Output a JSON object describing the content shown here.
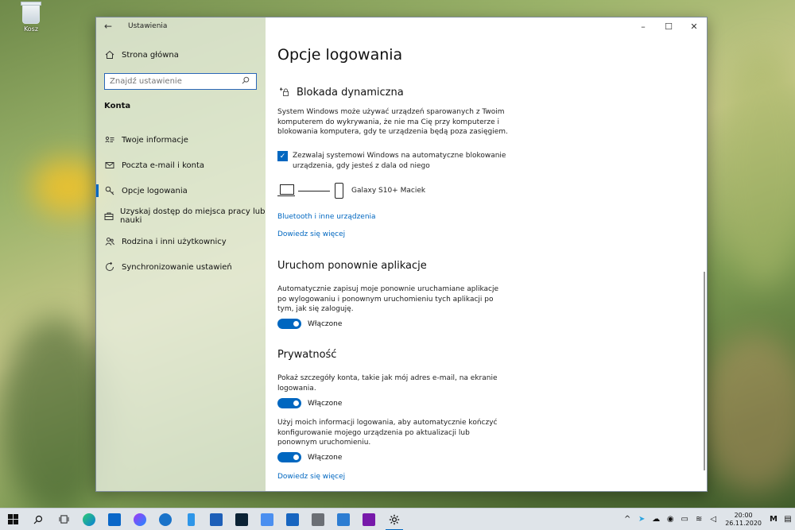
{
  "desktop": {
    "recycle_bin_label": "Kosz"
  },
  "window": {
    "title": "Ustawienia",
    "sidebar": {
      "home": "Strona główna",
      "search_placeholder": "Znajdź ustawienie",
      "section": "Konta",
      "items": [
        {
          "label": "Twoje informacje",
          "icon": "person-card-icon",
          "active": false
        },
        {
          "label": "Poczta e-mail i konta",
          "icon": "mail-icon",
          "active": false
        },
        {
          "label": "Opcje logowania",
          "icon": "key-icon",
          "active": true
        },
        {
          "label": "Uzyskaj dostęp do miejsca pracy lub nauki",
          "icon": "briefcase-icon",
          "active": false
        },
        {
          "label": "Rodzina i inni użytkownicy",
          "icon": "people-icon",
          "active": false
        },
        {
          "label": "Synchronizowanie ustawień",
          "icon": "sync-icon",
          "active": false
        }
      ]
    },
    "main": {
      "page_title": "Opcje logowania",
      "dynamic_lock": {
        "heading": "Blokada dynamiczna",
        "description": "System Windows może używać urządzeń sparowanych z Twoim komputerem do wykrywania, że nie ma Cię przy komputerze i blokowania komputera, gdy te urządzenia będą poza zasięgiem.",
        "checkbox_label": "Zezwalaj systemowi Windows na automatyczne blokowanie urządzenia, gdy jesteś z dala od niego",
        "checkbox_checked": true,
        "device_name": "Galaxy S10+ Maciek",
        "link_bluetooth": "Bluetooth i inne urządzenia",
        "link_more": "Dowiedz się więcej"
      },
      "restart_apps": {
        "heading": "Uruchom ponownie aplikacje",
        "description": "Automatycznie zapisuj moje ponownie uruchamiane aplikacje po wylogowaniu i ponownym uruchomieniu tych aplikacji po tym, jak się zaloguję.",
        "toggle_label": "Włączone"
      },
      "privacy": {
        "heading": "Prywatność",
        "description1": "Pokaż szczegóły konta, takie jak mój adres e-mail, na ekranie logowania.",
        "toggle1_label": "Włączone",
        "description2": "Użyj moich informacji logowania, aby automatycznie kończyć konfigurowanie mojego urządzenia po aktualizacji lub ponownym uruchomieniu.",
        "toggle2_label": "Włączone",
        "link_more": "Dowiedz się więcej"
      }
    }
  },
  "taskbar": {
    "time": "20:00",
    "date": "26.11.2020",
    "colors": {
      "accent": "#0067c0"
    }
  }
}
